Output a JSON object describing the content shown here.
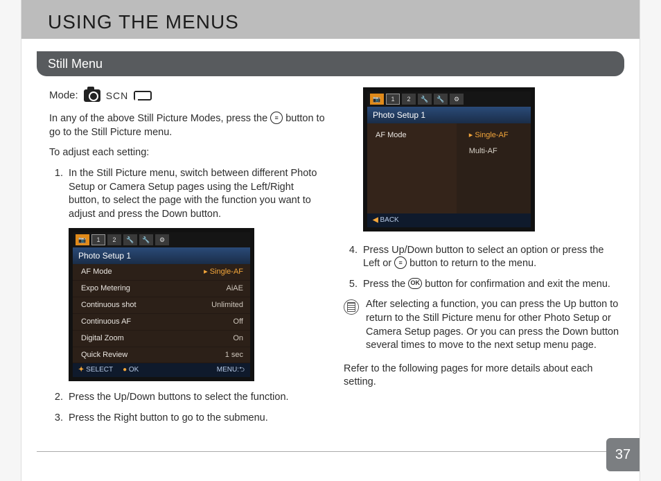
{
  "title": "USING THE MENUS",
  "section": "Still Menu",
  "mode_label": "Mode:",
  "scn": "SCN",
  "intro1_a": "In any of the above Still Picture Modes, press the ",
  "intro1_b": " button to go to the Still  Picture menu.",
  "intro2": "To adjust each setting:",
  "steps_left": [
    "In the Still Picture menu, switch between different Photo Setup or Camera Setup pages using the Left/Right button, to select the page with the function you want to adjust and press the Down button.",
    "Press the Up/Down buttons to select the function.",
    "Press the Right button to go to the submenu."
  ],
  "step4_a": "Press Up/Down button to select an option or press the Left or ",
  "step4_b": " button to return to the menu.",
  "step5_a": "Press the ",
  "step5_b": " button for confirmation and exit the menu.",
  "ok_label": "OK",
  "note_text": "After selecting a function, you can press the Up button to return to the Still Picture menu for other Photo Setup or Camera Setup pages. Or you can press the Down button several times to move to the next setup menu page.",
  "refer_text": "Refer to the following pages for more details about each setting.",
  "page_number": "37",
  "shot1": {
    "heading": "Photo Setup 1",
    "tabs": [
      "📷",
      "1",
      "2",
      "🔧",
      "🔧",
      "⚙"
    ],
    "rows": [
      {
        "k": "AF Mode",
        "v": "Single-AF",
        "hi": true
      },
      {
        "k": "Expo Metering",
        "v": "AiAE"
      },
      {
        "k": "Continuous shot",
        "v": "Unlimited"
      },
      {
        "k": "Continuous AF",
        "v": "Off"
      },
      {
        "k": "Digital Zoom",
        "v": "On"
      },
      {
        "k": "Quick Review",
        "v": "1 sec"
      }
    ],
    "footer": {
      "select": "SELECT",
      "ok": "OK",
      "menu": "MENU:⮌"
    }
  },
  "shot2": {
    "heading": "Photo Setup 1",
    "row_label": "AF Mode",
    "options": [
      {
        "label": "Single-AF",
        "hi": true
      },
      {
        "label": "Multi-AF"
      }
    ],
    "back": "BACK"
  }
}
